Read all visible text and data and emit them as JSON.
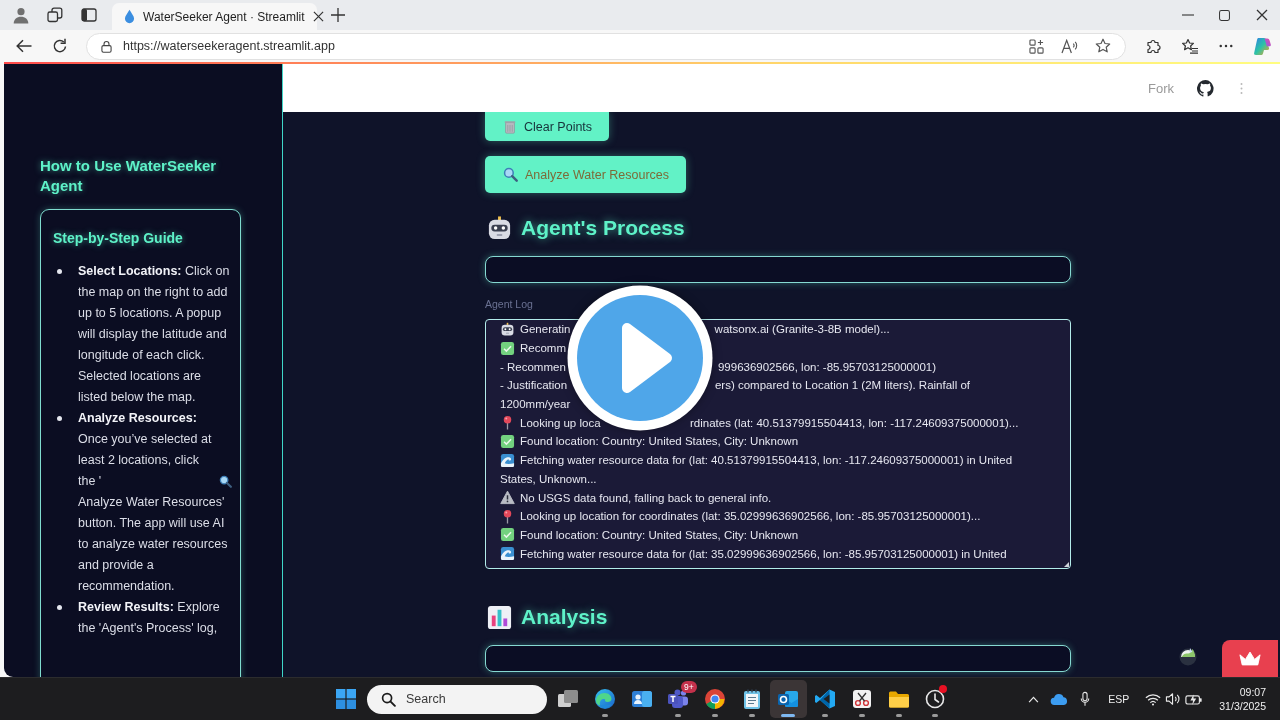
{
  "browser": {
    "tabs": [
      {
        "title": "WaterSeeker Agent · Streamlit",
        "selected": true
      }
    ],
    "address": {
      "value": "https://waterseekeragent.streamlit.app"
    }
  },
  "sidebar": {
    "title": "How to Use WaterSeeker Agent",
    "guide": {
      "title": "Step-by-Step Guide",
      "items": [
        {
          "kind": "plain",
          "text": "**Select Locations:** Click on the map on the right to add up to 5 locations. A popup will display the latitude and longitude of each click. Selected locations are listed below the map."
        },
        {
          "kind": "icon",
          "text": "**Analyze Resources:** Once you’ve selected at least 2 locations, click the '",
          "text_after": "Analyze Water Resources' button. The app will use AI to analyze water resources and provide a recommendation."
        },
        {
          "kind": "plain",
          "text": "**Review Results:** Explore the 'Agent's Process' log,"
        }
      ]
    }
  },
  "app_header": {
    "fork_label": "Fork"
  },
  "main": {
    "buttons": [
      {
        "kind": "clear",
        "label": "Clear Points"
      },
      {
        "kind": "analyze",
        "label": "Analyze Water Resources"
      }
    ],
    "sections": [
      {
        "kind": "process",
        "heading": "Agent's Process",
        "log_label": "Agent Log",
        "log_lines": [
          {
            "kind": "robot",
            "text": "Generatin",
            "text_after": "watsonx.ai (Granite-3-8B model)..."
          },
          {
            "kind": "check",
            "text": "Recomm"
          },
          {
            "kind": "plain",
            "text": "- Recommen",
            "text_after": "999636902566, lon: -85.95703125000001)"
          },
          {
            "kind": "plain",
            "text": "- Justification",
            "text_after": "ers) compared to Location 1 (2M liters). Rainfall of"
          },
          {
            "kind": "plain",
            "text": "1200mm/year"
          },
          {
            "kind": "pin",
            "text": "Looking up loca",
            "text_after": "rdinates (lat: 40.51379915504413, lon: -117.24609375000001)..."
          },
          {
            "kind": "check",
            "text": "Found location: Country: United States, City: Unknown"
          },
          {
            "kind": "wave",
            "text": "Fetching water resource data for (lat: 40.51379915504413, lon: -117.24609375000001) in United"
          },
          {
            "kind": "plain",
            "text": "States, Unknown..."
          },
          {
            "kind": "warning",
            "text": "No USGS data found, falling back to general info."
          },
          {
            "kind": "pin",
            "text": "Looking up location for coordinates (lat: 35.02999636902566, lon: -85.95703125000001)..."
          },
          {
            "kind": "check",
            "text": "Found location: Country: United States, City: Unknown"
          },
          {
            "kind": "wave",
            "text": "Fetching water resource data for (lat: 35.02999636902566, lon: -85.95703125000001) in United"
          }
        ]
      },
      {
        "kind": "analysis",
        "heading": "Analysis"
      }
    ]
  },
  "overlay": {
    "kind": "play"
  },
  "taskbar": {
    "search": {
      "placeholder": "Search"
    },
    "apps": [
      {
        "kind": "taskview",
        "running": false,
        "selected": false,
        "notification": false
      },
      {
        "kind": "edge",
        "running": true,
        "selected": false,
        "notification": false
      },
      {
        "kind": "contacts",
        "running": false,
        "selected": false,
        "notification": false
      },
      {
        "kind": "teams",
        "running": true,
        "selected": false,
        "notification": false,
        "badge": "9+"
      },
      {
        "kind": "chrome",
        "running": true,
        "selected": false,
        "notification": false
      },
      {
        "kind": "notepad",
        "running": true,
        "selected": false,
        "notification": false
      },
      {
        "kind": "outlook",
        "running": true,
        "selected": true,
        "notification": false
      },
      {
        "kind": "vscode",
        "running": true,
        "selected": false,
        "notification": false
      },
      {
        "kind": "snipping",
        "running": true,
        "selected": false,
        "notification": false
      },
      {
        "kind": "explorer",
        "running": true,
        "selected": false,
        "notification": false
      },
      {
        "kind": "dial",
        "running": true,
        "selected": false,
        "notification": true
      }
    ],
    "tray": {
      "language": "ESP",
      "time": "09:07",
      "date": "31/3/2025"
    }
  }
}
